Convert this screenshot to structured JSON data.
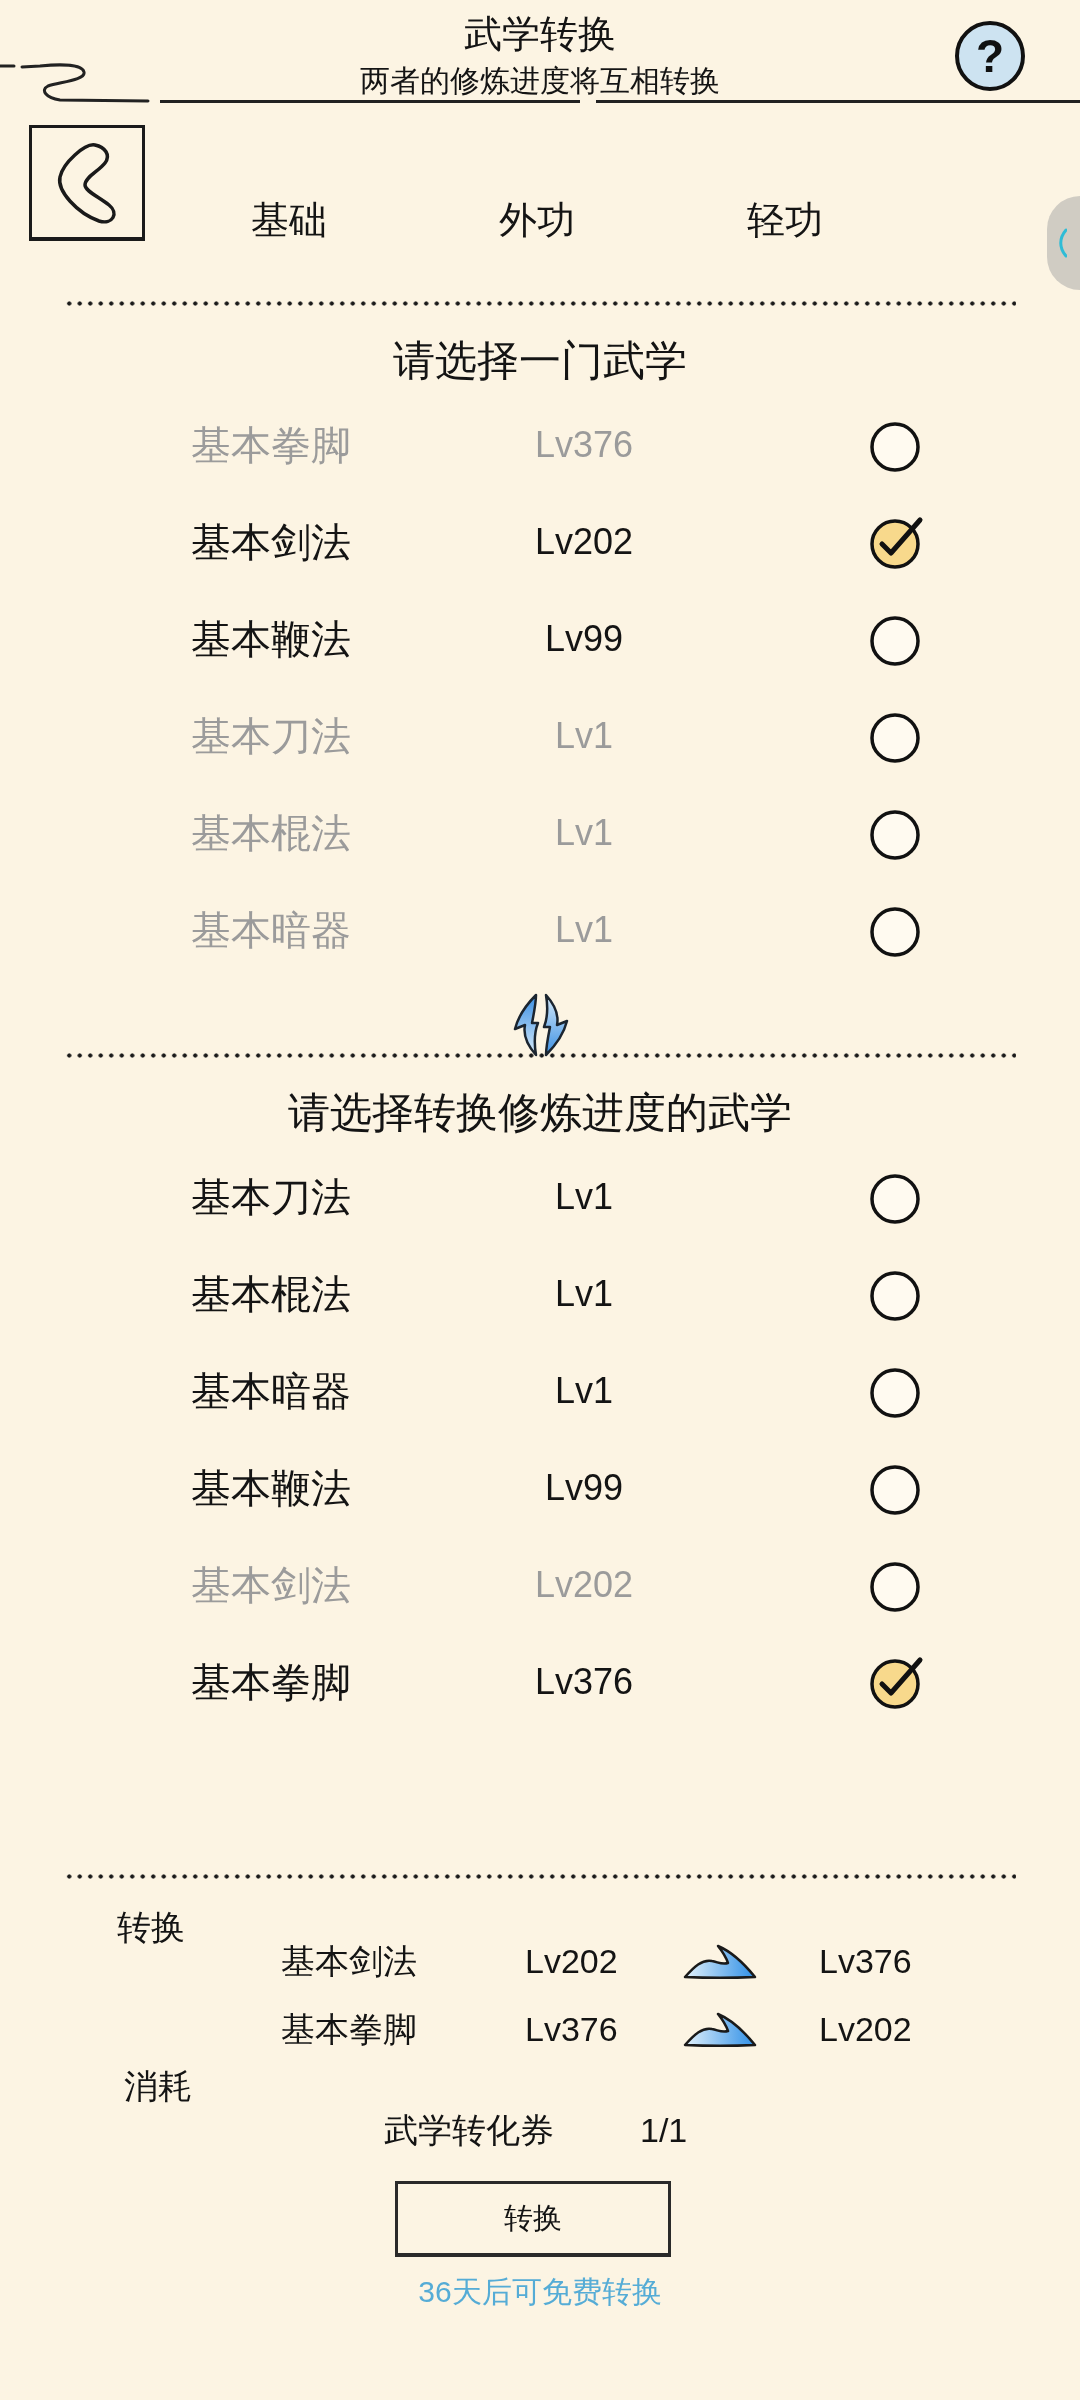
{
  "header": {
    "title": "武学转换",
    "subtitle": "两者的修炼进度将互相转换",
    "help_button": "?"
  },
  "tabs": [
    {
      "label": "基础"
    },
    {
      "label": "外功"
    },
    {
      "label": "轻功"
    }
  ],
  "lists": [
    {
      "heading": "请选择一门武学",
      "rows": [
        {
          "name": "基本拳脚",
          "lv": "Lv376",
          "disabled": true,
          "selected": false
        },
        {
          "name": "基本剑法",
          "lv": "Lv202",
          "disabled": false,
          "selected": true
        },
        {
          "name": "基本鞭法",
          "lv": "Lv99",
          "disabled": false,
          "selected": false
        },
        {
          "name": "基本刀法",
          "lv": "Lv1",
          "disabled": true,
          "selected": false
        },
        {
          "name": "基本棍法",
          "lv": "Lv1",
          "disabled": true,
          "selected": false
        },
        {
          "name": "基本暗器",
          "lv": "Lv1",
          "disabled": true,
          "selected": false
        }
      ]
    },
    {
      "heading": "请选择转换修炼进度的武学",
      "rows": [
        {
          "name": "基本刀法",
          "lv": "Lv1",
          "disabled": false,
          "selected": false
        },
        {
          "name": "基本棍法",
          "lv": "Lv1",
          "disabled": false,
          "selected": false
        },
        {
          "name": "基本暗器",
          "lv": "Lv1",
          "disabled": false,
          "selected": false
        },
        {
          "name": "基本鞭法",
          "lv": "Lv99",
          "disabled": false,
          "selected": false
        },
        {
          "name": "基本剑法",
          "lv": "Lv202",
          "disabled": true,
          "selected": false
        },
        {
          "name": "基本拳脚",
          "lv": "Lv376",
          "disabled": false,
          "selected": true
        }
      ]
    }
  ],
  "conversion": {
    "label": "转换",
    "rows": [
      {
        "name": "基本剑法",
        "from": "Lv202",
        "to": "Lv376"
      },
      {
        "name": "基本拳脚",
        "from": "Lv376",
        "to": "Lv202"
      }
    ]
  },
  "cost": {
    "label": "消耗",
    "item": "武学转化券",
    "count": "1/1"
  },
  "convert_button": "转换",
  "free_note": "36天后可免费转换"
}
